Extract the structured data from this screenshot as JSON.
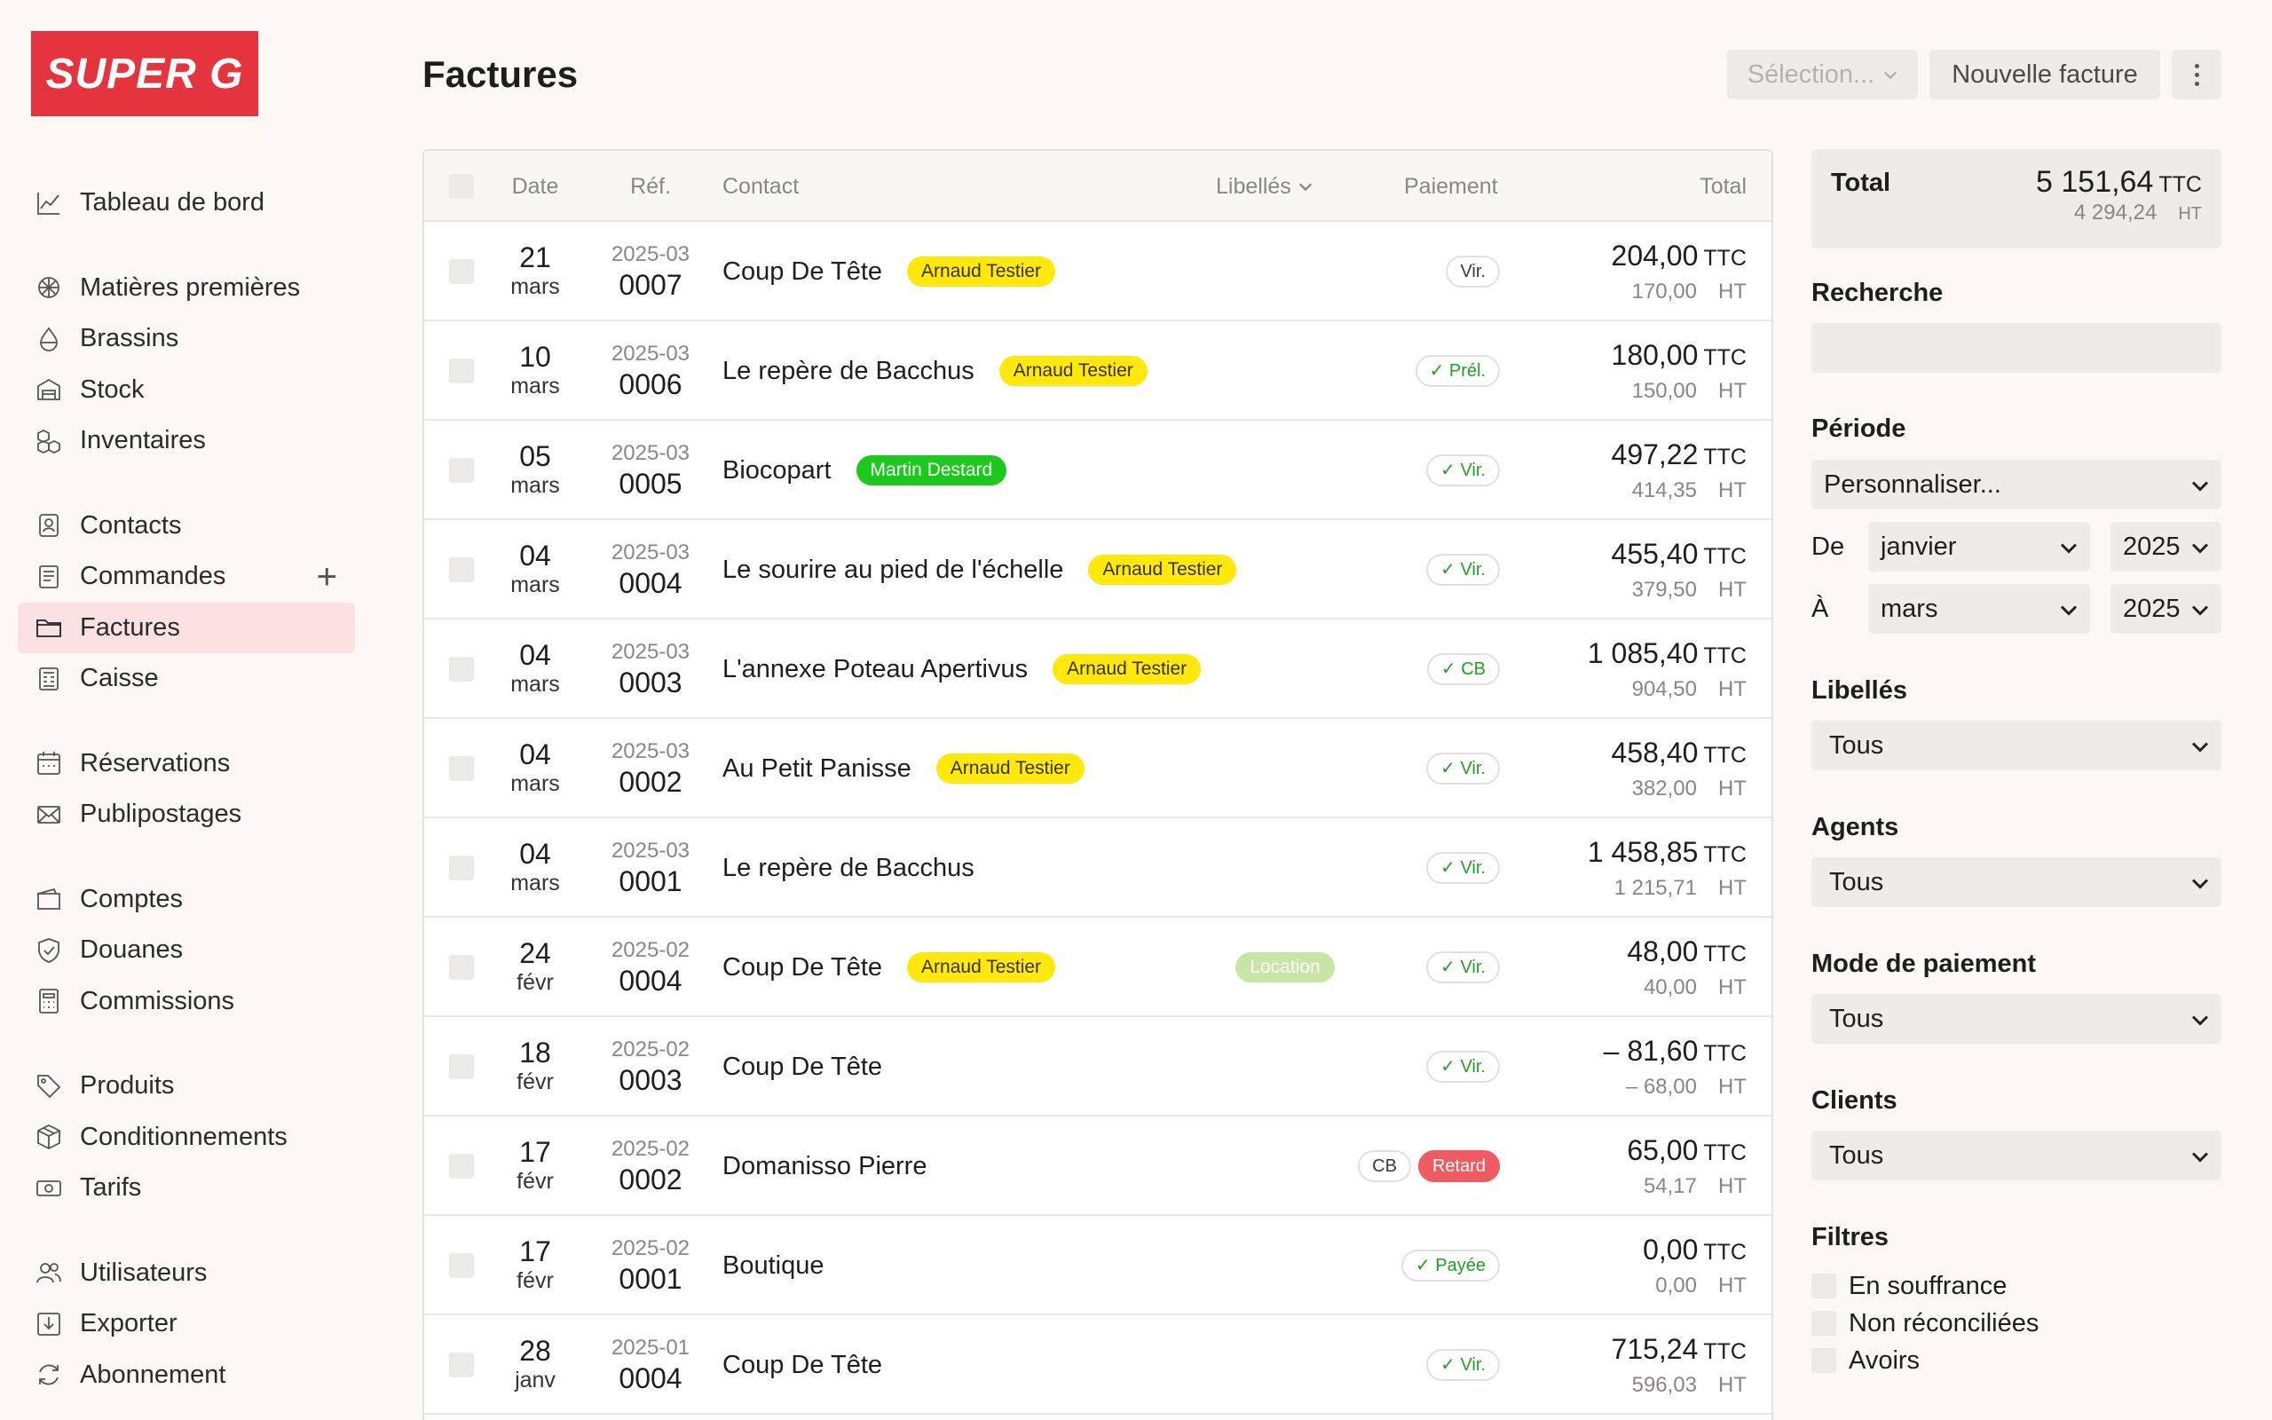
{
  "logo": "SUPER G",
  "sidebar": {
    "groups": [
      [
        {
          "label": "Tableau de bord",
          "icon": "chart-line-icon"
        }
      ],
      [
        {
          "label": "Matières premières",
          "icon": "hop-icon"
        },
        {
          "label": "Brassins",
          "icon": "drop-icon"
        },
        {
          "label": "Stock",
          "icon": "warehouse-icon"
        },
        {
          "label": "Inventaires",
          "icon": "boxes-icon"
        }
      ],
      [
        {
          "label": "Contacts",
          "icon": "contact-card-icon"
        },
        {
          "label": "Commandes",
          "icon": "receipt-icon"
        },
        {
          "label": "Factures",
          "icon": "folder-icon"
        },
        {
          "label": "Caisse",
          "icon": "cash-register-icon"
        }
      ],
      [
        {
          "label": "Réservations",
          "icon": "calendar-icon"
        },
        {
          "label": "Publipostages",
          "icon": "envelope-icon"
        }
      ],
      [
        {
          "label": "Comptes",
          "icon": "wallet-icon"
        },
        {
          "label": "Douanes",
          "icon": "shield-icon"
        },
        {
          "label": "Commissions",
          "icon": "calculator-icon"
        }
      ],
      [
        {
          "label": "Produits",
          "icon": "tag-icon"
        },
        {
          "label": "Conditionnements",
          "icon": "package-icon"
        },
        {
          "label": "Tarifs",
          "icon": "banknote-icon"
        }
      ],
      [
        {
          "label": "Utilisateurs",
          "icon": "users-icon"
        },
        {
          "label": "Exporter",
          "icon": "export-icon"
        },
        {
          "label": "Abonnement",
          "icon": "refresh-icon"
        }
      ]
    ],
    "active": "Factures",
    "add_symbol": "+"
  },
  "header": {
    "title": "Factures",
    "selection_label": "Sélection...",
    "new_invoice_label": "Nouvelle facture"
  },
  "table": {
    "columns": {
      "date": "Date",
      "ref": "Réf.",
      "contact": "Contact",
      "labels": "Libellés",
      "payment": "Paiement",
      "total": "Total"
    },
    "rows": [
      {
        "day": "21",
        "month": "mars",
        "ref_year": "2025-03",
        "ref_num": "0007",
        "contact": "Coup De Tête",
        "agent": "Arnaud Testier",
        "agent_color": "yellow",
        "label": "",
        "pay": [
          {
            "text": "Vir.",
            "style": "plain"
          }
        ],
        "ttc": "204,00",
        "ht": "170,00"
      },
      {
        "day": "10",
        "month": "mars",
        "ref_year": "2025-03",
        "ref_num": "0006",
        "contact": "Le repère de Bacchus",
        "agent": "Arnaud Testier",
        "agent_color": "yellow",
        "label": "",
        "pay": [
          {
            "text": "✓ Prél.",
            "style": "ok"
          }
        ],
        "ttc": "180,00",
        "ht": "150,00"
      },
      {
        "day": "05",
        "month": "mars",
        "ref_year": "2025-03",
        "ref_num": "0005",
        "contact": "Biocopart",
        "agent": "Martin Destard",
        "agent_color": "green",
        "label": "",
        "pay": [
          {
            "text": "✓ Vir.",
            "style": "ok"
          }
        ],
        "ttc": "497,22",
        "ht": "414,35"
      },
      {
        "day": "04",
        "month": "mars",
        "ref_year": "2025-03",
        "ref_num": "0004",
        "contact": "Le sourire au pied de l'échelle",
        "agent": "Arnaud Testier",
        "agent_color": "yellow",
        "label": "",
        "pay": [
          {
            "text": "✓ Vir.",
            "style": "ok"
          }
        ],
        "ttc": "455,40",
        "ht": "379,50"
      },
      {
        "day": "04",
        "month": "mars",
        "ref_year": "2025-03",
        "ref_num": "0003",
        "contact": "L'annexe Poteau Apertivus",
        "agent": "Arnaud Testier",
        "agent_color": "yellow",
        "label": "",
        "pay": [
          {
            "text": "✓ CB",
            "style": "ok"
          }
        ],
        "ttc": "1 085,40",
        "ht": "904,50"
      },
      {
        "day": "04",
        "month": "mars",
        "ref_year": "2025-03",
        "ref_num": "0002",
        "contact": "Au Petit Panisse",
        "agent": "Arnaud Testier",
        "agent_color": "yellow",
        "label": "",
        "pay": [
          {
            "text": "✓ Vir.",
            "style": "ok"
          }
        ],
        "ttc": "458,40",
        "ht": "382,00"
      },
      {
        "day": "04",
        "month": "mars",
        "ref_year": "2025-03",
        "ref_num": "0001",
        "contact": "Le repère de Bacchus",
        "agent": "",
        "agent_color": "",
        "label": "",
        "pay": [
          {
            "text": "✓ Vir.",
            "style": "ok"
          }
        ],
        "ttc": "1 458,85",
        "ht": "1 215,71"
      },
      {
        "day": "24",
        "month": "févr",
        "ref_year": "2025-02",
        "ref_num": "0004",
        "contact": "Coup De Tête",
        "agent": "Arnaud Testier",
        "agent_color": "yellow",
        "label": "Location",
        "pay": [
          {
            "text": "✓ Vir.",
            "style": "ok"
          }
        ],
        "ttc": "48,00",
        "ht": "40,00"
      },
      {
        "day": "18",
        "month": "févr",
        "ref_year": "2025-02",
        "ref_num": "0003",
        "contact": "Coup De Tête",
        "agent": "",
        "agent_color": "",
        "label": "",
        "pay": [
          {
            "text": "✓ Vir.",
            "style": "ok"
          }
        ],
        "ttc": "– 81,60",
        "ht": "– 68,00"
      },
      {
        "day": "17",
        "month": "févr",
        "ref_year": "2025-02",
        "ref_num": "0002",
        "contact": "Domanisso Pierre",
        "agent": "",
        "agent_color": "",
        "label": "",
        "pay": [
          {
            "text": "CB",
            "style": "plain"
          },
          {
            "text": "Retard",
            "style": "late"
          }
        ],
        "ttc": "65,00",
        "ht": "54,17"
      },
      {
        "day": "17",
        "month": "févr",
        "ref_year": "2025-02",
        "ref_num": "0001",
        "contact": "Boutique",
        "agent": "",
        "agent_color": "",
        "label": "",
        "pay": [
          {
            "text": "✓ Payée",
            "style": "ok"
          }
        ],
        "ttc": "0,00",
        "ht": "0,00"
      },
      {
        "day": "28",
        "month": "janv",
        "ref_year": "2025-01",
        "ref_num": "0004",
        "contact": "Coup De Tête",
        "agent": "",
        "agent_color": "",
        "label": "",
        "pay": [
          {
            "text": "✓ Vir.",
            "style": "ok"
          }
        ],
        "ttc": "715,24",
        "ht": "596,03"
      }
    ],
    "ttc_unit": "TTC",
    "ht_unit": "HT"
  },
  "panel": {
    "total_label": "Total",
    "total_ttc": "5 151,64",
    "total_ht": "4 294,24",
    "ttc_unit": "TTC",
    "ht_unit": "HT",
    "search_label": "Recherche",
    "search_value": "",
    "period_label": "Période",
    "period_value": "Personnaliser...",
    "from_label": "De",
    "from_month": "janvier",
    "from_year": "2025",
    "to_label": "À",
    "to_month": "mars",
    "to_year": "2025",
    "labels_label": "Libellés",
    "labels_value": "Tous",
    "agents_label": "Agents",
    "agents_value": "Tous",
    "payment_label": "Mode de paiement",
    "payment_value": "Tous",
    "clients_label": "Clients",
    "clients_value": "Tous",
    "filters_label": "Filtres",
    "filters": [
      "En souffrance",
      "Non réconciliées",
      "Avoirs"
    ]
  },
  "colors": {
    "brand": "#e5343d",
    "active_bg": "#fbe1e2",
    "agent_yellow": "#ffe80a",
    "agent_green": "#1ec91e",
    "late": "#ee5b61",
    "ok": "#1fa11f"
  }
}
